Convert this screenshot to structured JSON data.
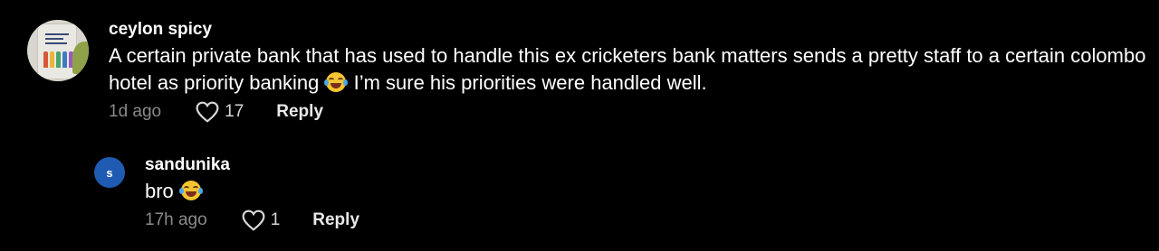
{
  "comments": [
    {
      "username": "ceylon spicy",
      "text_before_emoji": "A certain private bank that has used to handle this ex cricketers bank matters sends a pretty staff to a certain colombo hotel as priority banking ",
      "text_after_emoji": " I’m sure his priorities were handled well.",
      "emoji": "face-with-tears-of-joy",
      "time": "1d ago",
      "likes": "17",
      "reply_label": "Reply"
    },
    {
      "username": "sandunika",
      "avatar_letter": "s",
      "avatar_color": "#1f5bb3",
      "text_before_emoji": "bro ",
      "emoji": "face-with-tears-of-joy",
      "time": "17h ago",
      "likes": "1",
      "reply_label": "Reply"
    }
  ],
  "colors": {
    "background": "#000000",
    "text": "#ffffff",
    "secondary_text": "#8a8a8a",
    "emoji_yellow": "#f7c531"
  }
}
